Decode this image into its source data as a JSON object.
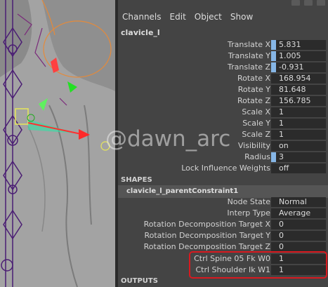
{
  "menu": [
    "Channels",
    "Edit",
    "Object",
    "Show"
  ],
  "node_name": "clavicle_l",
  "attributes": [
    {
      "label": "Translate X",
      "value": "5.831",
      "keyed": true
    },
    {
      "label": "Translate Y",
      "value": "1.005",
      "keyed": true
    },
    {
      "label": "Translate Z",
      "value": "-0.931",
      "keyed": true
    },
    {
      "label": "Rotate X",
      "value": "168.954",
      "keyed": false
    },
    {
      "label": "Rotate Y",
      "value": "81.648",
      "keyed": false
    },
    {
      "label": "Rotate Z",
      "value": "156.785",
      "keyed": false
    },
    {
      "label": "Scale X",
      "value": "1",
      "keyed": false
    },
    {
      "label": "Scale Y",
      "value": "1",
      "keyed": false
    },
    {
      "label": "Scale Z",
      "value": "1",
      "keyed": false
    },
    {
      "label": "Visibility",
      "value": "on",
      "keyed": false
    },
    {
      "label": "Radius",
      "value": "3",
      "keyed": true
    },
    {
      "label": "Lock Influence Weights",
      "value": "off",
      "keyed": false
    }
  ],
  "shapes_header": "SHAPES",
  "constraint_name": "clavicle_l_parentConstraint1",
  "constraint_attributes": [
    {
      "label": "Node State",
      "value": "Normal"
    },
    {
      "label": "Interp Type",
      "value": "Average"
    },
    {
      "label": "Rotation Decomposition Target X",
      "value": "0"
    },
    {
      "label": "Rotation Decomposition Target Y",
      "value": "0"
    },
    {
      "label": "Rotation Decomposition Target Z",
      "value": "0"
    },
    {
      "label": "Ctrl Spine 05 Fk W0",
      "value": "1"
    },
    {
      "label": "Ctrl Shoulder Ik W1",
      "value": "1"
    }
  ],
  "outputs_header": "OUTPUTS",
  "watermark": "@dawn_arc",
  "colors": {
    "highlight": "#d9191f",
    "keyed": "#86b6e6",
    "panel": "#444444",
    "field": "#2b2b2b"
  }
}
